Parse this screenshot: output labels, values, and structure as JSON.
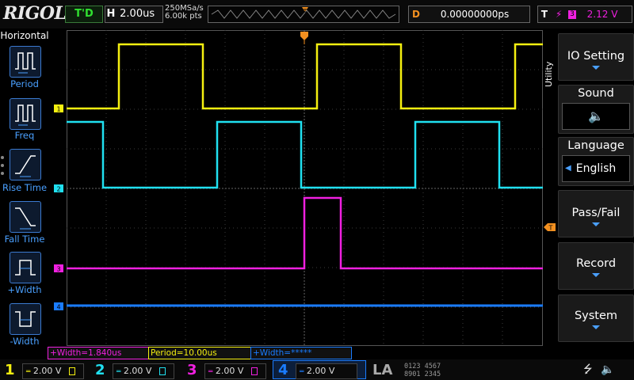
{
  "brand": "RIGOL",
  "trigger_status": "T'D",
  "horizontal": {
    "key": "H",
    "timebase": "2.00us",
    "sample_rate": "250MSa/s",
    "memory_depth": "6.00k pts"
  },
  "delay": {
    "key": "D",
    "value": "0.00000000ps"
  },
  "trigger": {
    "key": "T",
    "source": "3",
    "level": "2.12 V"
  },
  "left_panel": {
    "title": "Horizontal",
    "items": [
      {
        "label": "Period"
      },
      {
        "label": "Freq"
      },
      {
        "label": "Rise Time"
      },
      {
        "label": "Fall Time"
      },
      {
        "label": "+Width"
      },
      {
        "label": "-Width"
      }
    ]
  },
  "right_panel": {
    "section": "Utility",
    "items": [
      {
        "label": "IO Setting"
      },
      {
        "label": "Sound"
      },
      {
        "label": "Language",
        "value": "English"
      },
      {
        "label": "Pass/Fail"
      },
      {
        "label": "Record"
      },
      {
        "label": "System"
      }
    ]
  },
  "measurements": [
    {
      "text": "+Width=1.840us"
    },
    {
      "text": "Period=10.00us"
    },
    {
      "text": "+Width=*****"
    }
  ],
  "channels": [
    {
      "num": "1",
      "scale": "2.00 V",
      "color": "#f5f010"
    },
    {
      "num": "2",
      "scale": "2.00 V",
      "color": "#20e0f0"
    },
    {
      "num": "3",
      "scale": "2.00 V",
      "color": "#f020e0"
    },
    {
      "num": "4",
      "scale": "2.00 V",
      "color": "#1a7cff"
    }
  ],
  "la": {
    "label": "LA",
    "row1": "0123 4567",
    "row2": "8901 2345"
  },
  "colors": {
    "ch1": "#f5f010",
    "ch2": "#20e0f0",
    "ch3": "#f020e0",
    "ch4": "#1a7cff",
    "accent": "#3b7ad0",
    "trigger": "#f39020"
  }
}
